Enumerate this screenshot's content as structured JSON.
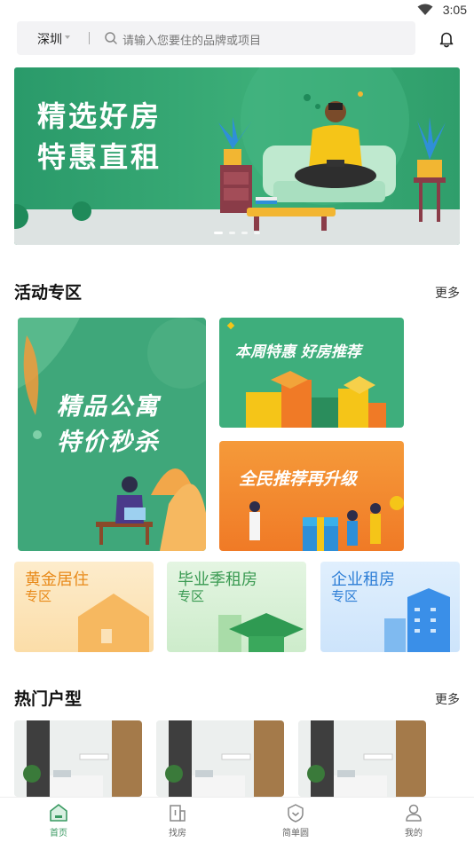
{
  "status": {
    "time": "3:05",
    "wifi_icon": "wifi-icon"
  },
  "header": {
    "city": "深圳",
    "search_placeholder": "请输入您要住的品牌或项目",
    "bell_icon": "bell-icon"
  },
  "banner": {
    "line1": "精选好房",
    "line2": "特惠直租",
    "page_count": 4,
    "active_page": 1
  },
  "activity": {
    "title": "活动专区",
    "more": "更多",
    "big_card": {
      "line1": "精品公寓",
      "line2": "特价秒杀"
    },
    "weekly_card": {
      "label": "本周特惠 好房推荐"
    },
    "refer_card": {
      "label": "全民推荐再升级"
    }
  },
  "zones": [
    {
      "title": "黄金居住",
      "sub": "专区",
      "color": "#e88a1a"
    },
    {
      "title": "毕业季租房",
      "sub": "专区",
      "color": "#3a9a52"
    },
    {
      "title": "企业租房",
      "sub": "专区",
      "color": "#2d7ed6"
    }
  ],
  "hot": {
    "title": "热门户型",
    "more": "更多",
    "room_count": 3
  },
  "tabbar": {
    "tabs": [
      {
        "label": "首页",
        "icon": "home-icon",
        "active": true
      },
      {
        "label": "找房",
        "icon": "building-icon",
        "active": false
      },
      {
        "label": "简单圆",
        "icon": "shield-icon",
        "active": false
      },
      {
        "label": "我的",
        "icon": "user-icon",
        "active": false
      }
    ]
  },
  "colors": {
    "accent": "#3a9a62",
    "banner_green": "#3cae78",
    "orange": "#f07a26"
  }
}
